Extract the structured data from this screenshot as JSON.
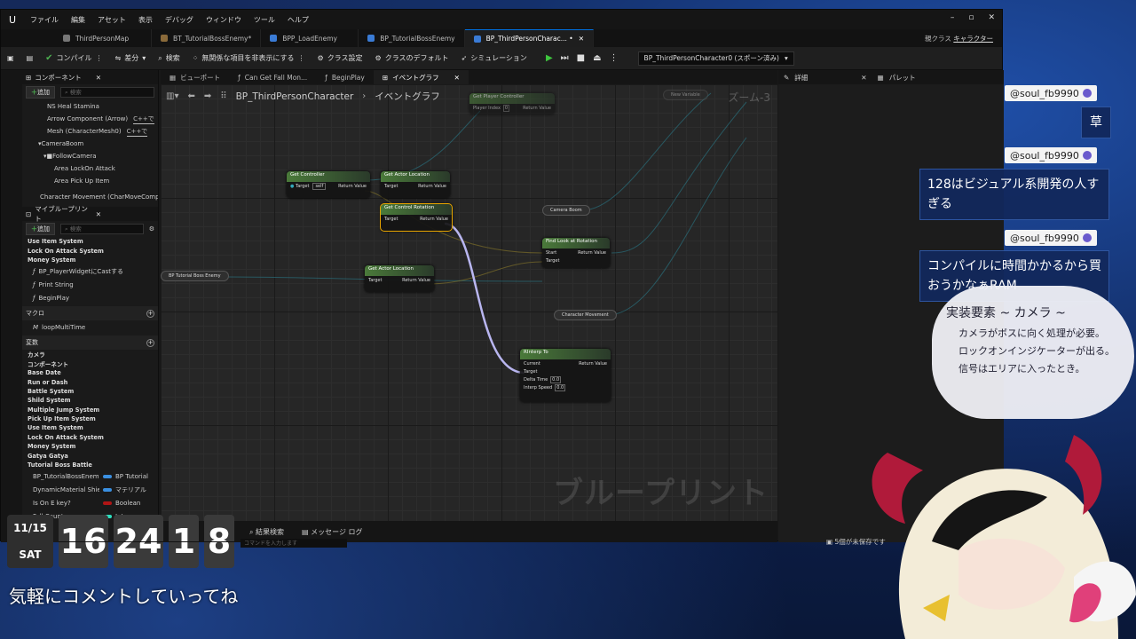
{
  "menubar": {
    "logo": "U",
    "items": [
      "ファイル",
      "編集",
      "アセット",
      "表示",
      "デバッグ",
      "ウィンドウ",
      "ツール",
      "ヘルプ"
    ]
  },
  "tabs": [
    {
      "label": "ThirdPersonMap"
    },
    {
      "label": "BT_TutorialBossEnemy*"
    },
    {
      "label": "BPP_LoadEnemy"
    },
    {
      "label": "BP_TutorialBossEnemy"
    },
    {
      "label": "BP_ThirdPersonCharac... •"
    }
  ],
  "parent_class": {
    "label": "親クラス",
    "value": "キャラクター"
  },
  "toolbar": {
    "compile": "コンパイル",
    "diff": "差分",
    "search": "検索",
    "hide_unrelated": "無関係な項目を非表示にする",
    "class_settings": "クラス設定",
    "class_defaults": "クラスのデフォルト",
    "simulation": "シミュレーション",
    "debug_object": "BP_ThirdPersonCharacter0 (スポーン済み)"
  },
  "components": {
    "title": "コンポーネント",
    "add": "追加",
    "search_placeholder": "検索",
    "items": [
      "NS Heal Stamina",
      "Arrow Component (Arrow)",
      "Mesh (CharacterMesh0)",
      "CameraBoom",
      "FollowCamera",
      "Area LockOn Attack",
      "Area Pick Up Item",
      "Character Movement (CharMoveComp)"
    ],
    "cpp1": "C++で",
    "cpp2": "C++で"
  },
  "myblueprint": {
    "title": "マイブループリント",
    "add": "追加",
    "search_placeholder": "検索",
    "graph_items": [
      "Use Item System",
      "Lock On Attack System",
      "Money System"
    ],
    "funcs": [
      "BP_PlayerWidgetにCastする",
      "Print String",
      "BeginPlay"
    ],
    "macros_title": "マクロ",
    "macros": [
      "loopMultiTime"
    ],
    "vars_title": "変数",
    "var_cats": [
      "カメラ",
      "コンポーネント",
      "Base Date",
      "Run or Dash",
      "Battle System",
      "Shild System",
      "Multiple Jump System",
      "Pick Up Item System",
      "Use Item System",
      "Lock On Attack System",
      "Money System",
      "Gatya Gatya",
      "Tutorial Boss Battle"
    ],
    "vars": [
      {
        "name": "BP_TutorialBossEnemy",
        "type": "BP Tutorial",
        "color": "#3a8fe0"
      },
      {
        "name": "DynamicMaterial Shield",
        "type": "マテリアル",
        "color": "#3a8fe0"
      },
      {
        "name": "Is On E key?",
        "type": "Boolean",
        "color": "#b01515"
      },
      {
        "name": "Fall Counter",
        "type": "Integer",
        "color": "#2ee0c0"
      }
    ]
  },
  "graph_tabs": [
    "ビューポート",
    "Can Get Fall Mon...",
    "BeginPlay",
    "イベントグラフ"
  ],
  "breadcrumb": {
    "bp": "BP_ThirdPersonCharacter",
    "graph": "イベントグラフ"
  },
  "watermark": "ブループリント",
  "nodes": {
    "get_controller": {
      "title": "Get Controller",
      "sub": "Target is Pawn",
      "target": "Target",
      "self": "self",
      "ret": "Return Value"
    },
    "get_actor_loc1": {
      "title": "Get Actor Location",
      "sub": "Target is Actor",
      "target": "Target",
      "ret": "Return Value"
    },
    "get_ctrl_rot": {
      "title": "Get Control Rotation",
      "sub": "Target is Controller",
      "target": "Target",
      "ret": "Return Value"
    },
    "camera_boom": "Camera Boom",
    "find_look": {
      "title": "Find Look at Rotation",
      "start": "Start",
      "target": "Target",
      "ret": "Return Value"
    },
    "tutorial_enemy": "BP Tutorial Boss Enemy",
    "get_actor_loc2": {
      "title": "Get Actor Location",
      "sub": "Target is Actor",
      "target": "Target",
      "ret": "Return Value"
    },
    "char_movement": "Character Movement",
    "rinterp": {
      "title": "RInterp To",
      "current": "Current",
      "target": "Target",
      "delta": "Delta Time",
      "delta_v": "0.0",
      "speed": "Interp Speed",
      "speed_v": "0.0",
      "ret": "Return Value"
    },
    "get_player_ctrl": {
      "title": "Get Player Controller",
      "idx": "Player Index",
      "idx_v": "0",
      "ret": "Return Value"
    },
    "new_variable": "New Variable",
    "zoom": "ズーム-3"
  },
  "bottom": {
    "results": "結果検索",
    "log": "メッセージ ログ",
    "cmd": "コマンドを入力します"
  },
  "right": {
    "details": "詳細",
    "palette": "パレット"
  },
  "status": "5個が未保存です",
  "chat": [
    {
      "user": "@soul_fb9990",
      "msg": "草"
    },
    {
      "user": "@soul_fb9990",
      "msg": "128はビジュアル系開発の人すぎる"
    },
    {
      "user": "@soul_fb9990",
      "msg": "コンパイルに時間かかるから買おうかなぁRAM"
    }
  ],
  "memo": {
    "title": "実装要素 ~ カメラ ~",
    "lines": [
      "カメラがボスに向く処理が必要。",
      "ロックオンインジケーターが出る。",
      "信号はエリアに入ったとき。"
    ]
  },
  "clock": {
    "date": "11/15",
    "day": "SAT",
    "h": "16",
    "m": "24",
    "s1": "1",
    "s2": "8"
  },
  "footer": "気軽にコメントしていってね"
}
